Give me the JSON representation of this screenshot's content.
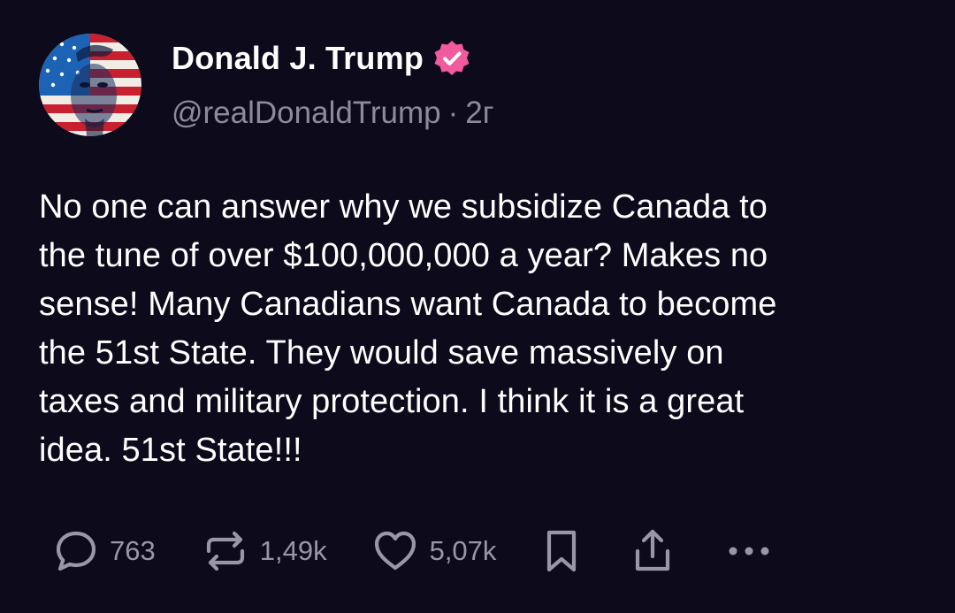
{
  "author": {
    "display_name": "Donald J. Trump",
    "handle": "@realDonaldTrump",
    "separator": "·",
    "timestamp": "2г",
    "verified": true,
    "verified_color": "#f25a9e"
  },
  "post": {
    "lines": [
      "No one can answer why we subsidize Canada to",
      "the tune of over $100,000,000 a year? Makes no",
      "sense! Many Canadians want Canada to become",
      "the 51st State. They would save massively on",
      "taxes and military protection. I think it is a great",
      "idea. 51st State!!!"
    ]
  },
  "actions": {
    "replies": "763",
    "reposts": "1,49k",
    "likes": "5,07k",
    "reply_icon": "speech-bubble-icon",
    "repost_icon": "repost-arrows-icon",
    "like_icon": "heart-icon",
    "bookmark_icon": "bookmark-icon",
    "share_icon": "share-upload-icon",
    "more_icon": "more-dots-icon"
  },
  "colors": {
    "background": "#0c0a1b",
    "text": "#ffffff",
    "muted": "#8e8a9a",
    "icon": "#9a96a8"
  }
}
